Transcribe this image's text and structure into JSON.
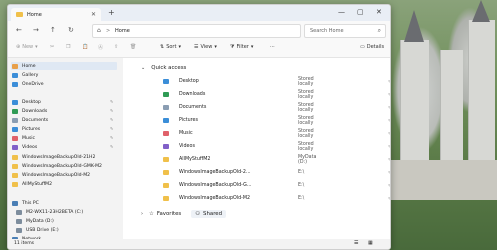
{
  "window": {
    "tab_title": "Home",
    "new_tab": "+",
    "controls": [
      "—",
      "▢",
      "✕"
    ]
  },
  "address": {
    "path": "Home",
    "separator": ">",
    "search_placeholder": "Search Home"
  },
  "toolbar": {
    "new_label": "New",
    "sort_label": "Sort",
    "view_label": "View",
    "filter_label": "Filter",
    "details_label": "Details"
  },
  "nav": {
    "top": [
      "Home",
      "Gallery",
      "OneDrive"
    ],
    "pinned": [
      "Desktop",
      "Downloads",
      "Documents",
      "Pictures",
      "Music",
      "Videos"
    ],
    "folders": [
      "WindowsImageBackupOld-21H2",
      "WindowsImageBackupOld-GMK-M2",
      "WindowsImageBackupOld-M2",
      "AllMyStuffM2"
    ],
    "thispc": "This PC",
    "drives": [
      "M2-WX11-23H2BETA (C:)",
      "MyData (D:)",
      "USB Drive (E:)"
    ],
    "network": "Network"
  },
  "content": {
    "quick_access": "Quick access",
    "rows": [
      {
        "name": "Desktop",
        "loc": "Stored locally",
        "icon": "desktop-icon"
      },
      {
        "name": "Downloads",
        "loc": "Stored locally",
        "icon": "downloads-icon"
      },
      {
        "name": "Documents",
        "loc": "Stored locally",
        "icon": "documents-icon"
      },
      {
        "name": "Pictures",
        "loc": "Stored locally",
        "icon": "pictures-icon"
      },
      {
        "name": "Music",
        "loc": "Stored locally",
        "icon": "music-icon"
      },
      {
        "name": "Videos",
        "loc": "Stored locally",
        "icon": "videos-icon"
      },
      {
        "name": "AllMyStuffM2",
        "loc": "MyData (D:)",
        "icon": "folder-icon"
      },
      {
        "name": "WindowsImageBackupOld-2...",
        "loc": "E:\\",
        "icon": "folder-icon"
      },
      {
        "name": "WindowsImageBackupOld-G...",
        "loc": "E:\\",
        "icon": "folder-icon"
      },
      {
        "name": "WindowsImageBackupOld-M2",
        "loc": "E:\\",
        "icon": "folder-icon"
      }
    ],
    "favorites": "Favorites",
    "shared": "Shared"
  },
  "status": {
    "items": "11 items"
  }
}
